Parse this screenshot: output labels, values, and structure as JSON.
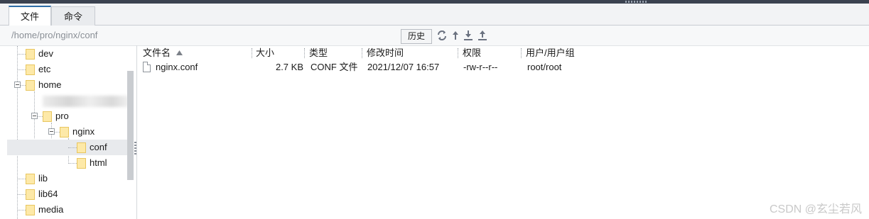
{
  "tabs": [
    {
      "label": "文件",
      "active": true
    },
    {
      "label": "命令",
      "active": false
    }
  ],
  "path": {
    "value": "/home/pro/nginx/conf"
  },
  "toolbar": {
    "history_label": "历史"
  },
  "tree": [
    {
      "label": "dev"
    },
    {
      "label": "etc"
    },
    {
      "label": "home",
      "expanded": true
    },
    {
      "label": "pro",
      "expanded": true
    },
    {
      "label": "nginx",
      "expanded": true
    },
    {
      "label": "conf",
      "selected": true
    },
    {
      "label": "html"
    },
    {
      "label": "lib"
    },
    {
      "label": "lib64"
    },
    {
      "label": "media"
    }
  ],
  "columns": [
    "文件名",
    "大小",
    "类型",
    "修改时间",
    "权限",
    "用户/用户组"
  ],
  "files": [
    {
      "name": "nginx.conf",
      "size": "2.7 KB",
      "type": "CONF 文件",
      "modified": "2021/12/07 16:57",
      "perms": "-rw-r--r--",
      "owner": "root/root"
    }
  ],
  "watermark": "CSDN @玄尘若风"
}
